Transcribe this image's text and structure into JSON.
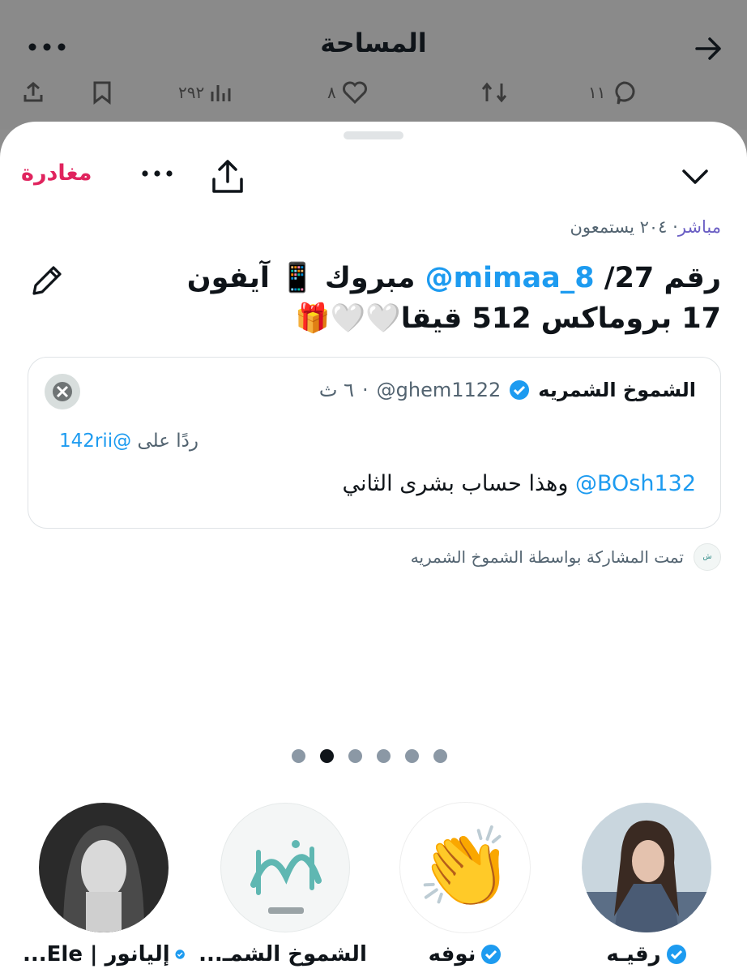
{
  "background": {
    "title": "المساحة",
    "actions": [
      {
        "icon": "share-icon",
        "count": ""
      },
      {
        "icon": "bookmark-icon",
        "count": ""
      },
      {
        "icon": "views-icon",
        "count": "٢٩٢"
      },
      {
        "icon": "heart-icon",
        "count": "٨"
      },
      {
        "icon": "retweet-icon",
        "count": ""
      },
      {
        "icon": "reply-icon",
        "count": "١١"
      }
    ]
  },
  "sheet": {
    "leave_label": "مغادرة",
    "live_label": "مباشر",
    "listeners": "٢٠٤ يستمعون",
    "title_part1": "رقم 27/ ",
    "title_mention": "@mimaa_8",
    "title_part2": " مبروك 📱 آيفون 17 بروماكس 512 قيقا🤍🤍🎁",
    "quote": {
      "name": "الشموخ الشمريه",
      "handle": "@ghem1122",
      "time": "٦ ث",
      "reply_prefix": "ردًا على",
      "reply_mention": "@142rii",
      "text": "وهذا حساب بشرى الثاني",
      "text_mention": "@BOsh132"
    },
    "shared_by": "تمت المشاركة بواسطة الشموخ الشمريه",
    "pager": {
      "count": 6,
      "active": 1
    },
    "speakers": [
      {
        "name": "رقيـه",
        "sub": "",
        "verified": true,
        "avatar": "photo-woman"
      },
      {
        "name": "نوفه",
        "sub": "",
        "verified": true,
        "avatar": "clapping-emoji"
      },
      {
        "name": "الشموخ الشمـ...",
        "sub": "",
        "verified": true,
        "avatar": "logo-alshumukh"
      },
      {
        "name": "إليانور | Ele...",
        "sub": "",
        "verified": true,
        "avatar": "photo-bw-woman"
      }
    ]
  },
  "colors": {
    "leave": "#e0245e",
    "mention": "#1d9bf0",
    "live": "#6b5fc4",
    "verified": "#1d9bf0"
  }
}
